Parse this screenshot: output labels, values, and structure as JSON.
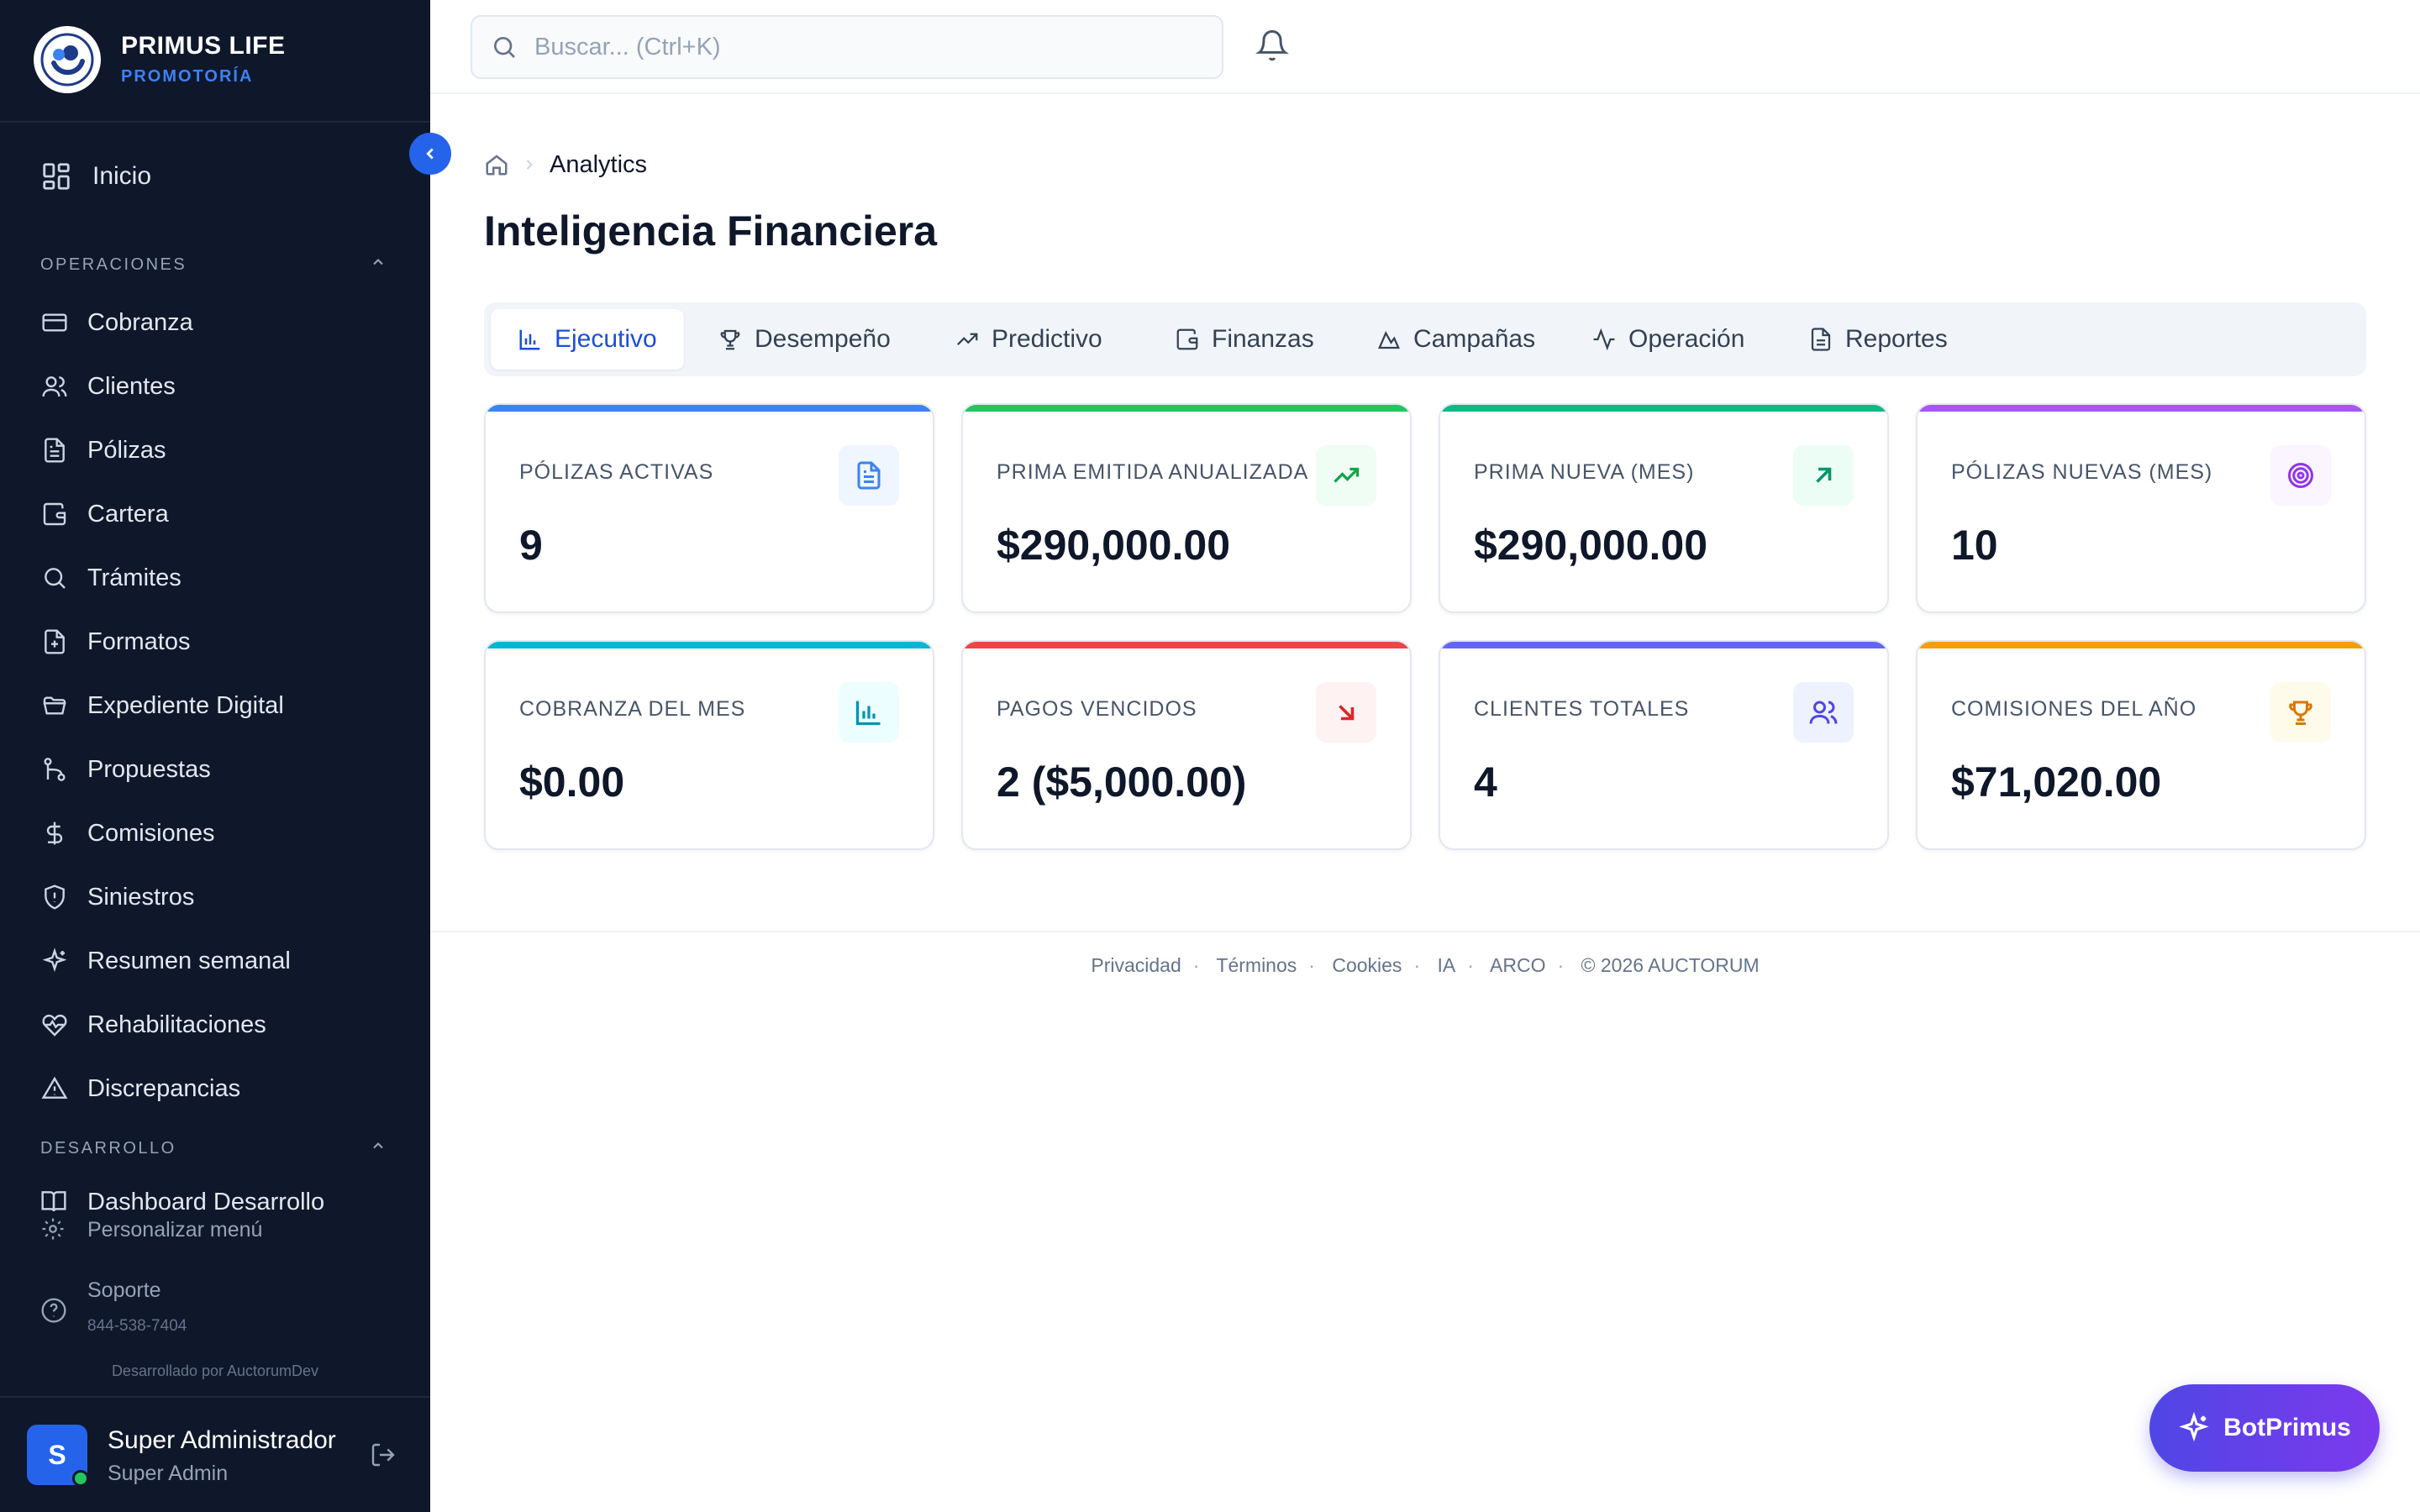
{
  "brand": {
    "name": "PRIMUS LIFE",
    "subtitle": "PROMOTORÍA"
  },
  "sidebar": {
    "home": "Inicio",
    "sections": [
      {
        "label": "OPERACIONES"
      },
      {
        "label": "DESARROLLO"
      }
    ],
    "items": [
      {
        "label": "Cobranza",
        "icon": "credit-card-icon"
      },
      {
        "label": "Clientes",
        "icon": "users-icon"
      },
      {
        "label": "Pólizas",
        "icon": "document-icon"
      },
      {
        "label": "Cartera",
        "icon": "wallet-icon"
      },
      {
        "label": "Trámites",
        "icon": "search-icon"
      },
      {
        "label": "Formatos",
        "icon": "file-plus-icon"
      },
      {
        "label": "Expediente Digital",
        "icon": "folder-open-icon"
      },
      {
        "label": "Propuestas",
        "icon": "git-branch-icon"
      },
      {
        "label": "Comisiones",
        "icon": "dollar-icon"
      },
      {
        "label": "Siniestros",
        "icon": "shield-alert-icon"
      },
      {
        "label": "Resumen semanal",
        "icon": "sparkles-icon"
      },
      {
        "label": "Rehabilitaciones",
        "icon": "heart-pulse-icon"
      },
      {
        "label": "Discrepancias",
        "icon": "alert-triangle-icon"
      }
    ],
    "dev_item": "Dashboard Desarrollo",
    "personalize": "Personalizar menú",
    "support": {
      "title": "Soporte",
      "phone": "844-538-7404"
    },
    "credit": "Desarrollado por AuctorumDev"
  },
  "user": {
    "initial": "S",
    "name": "Super Administrador",
    "role": "Super Admin"
  },
  "search": {
    "placeholder": "Buscar... (Ctrl+K)",
    "value": ""
  },
  "breadcrumb": {
    "current": "Analytics"
  },
  "page": {
    "title": "Inteligencia Financiera"
  },
  "tabs": [
    {
      "label": "Ejecutivo",
      "icon": "bar-chart-icon",
      "active": true
    },
    {
      "label": "Desempeño",
      "icon": "trophy-icon"
    },
    {
      "label": "Predictivo",
      "icon": "trending-up-icon"
    },
    {
      "label": "Finanzas",
      "icon": "wallet-icon"
    },
    {
      "label": "Campañas",
      "icon": "mountain-icon"
    },
    {
      "label": "Operación",
      "icon": "activity-icon"
    },
    {
      "label": "Reportes",
      "icon": "file-text-icon"
    }
  ],
  "kpis": [
    {
      "label": "PÓLIZAS ACTIVAS",
      "value": "9",
      "accent": "#3b82f6",
      "icon": "document-icon"
    },
    {
      "label": "PRIMA EMITIDA ANUALIZADA",
      "value": "$290,000.00",
      "accent": "#22c55e",
      "icon": "trending-up-icon"
    },
    {
      "label": "PRIMA NUEVA (MES)",
      "value": "$290,000.00",
      "accent": "#10b981",
      "icon": "arrow-up-right-icon"
    },
    {
      "label": "PÓLIZAS NUEVAS (MES)",
      "value": "10",
      "accent": "#a855f7",
      "icon": "target-icon"
    },
    {
      "label": "COBRANZA DEL MES",
      "value": "$0.00",
      "accent": "#06b6d4",
      "icon": "bar-chart-icon"
    },
    {
      "label": "PAGOS VENCIDOS",
      "value": "2 ($5,000.00)",
      "accent": "#ef4444",
      "icon": "arrow-down-right-icon"
    },
    {
      "label": "CLIENTES TOTALES",
      "value": "4",
      "accent": "#6366f1",
      "icon": "users-icon"
    },
    {
      "label": "COMISIONES DEL AÑO",
      "value": "$71,020.00",
      "accent": "#f59e0b",
      "icon": "trophy-icon"
    }
  ],
  "footer": {
    "links": [
      "Privacidad",
      "Términos",
      "Cookies",
      "IA",
      "ARCO",
      "© 2026 AUCTORUM"
    ]
  },
  "bot": {
    "label": "BotPrimus"
  }
}
